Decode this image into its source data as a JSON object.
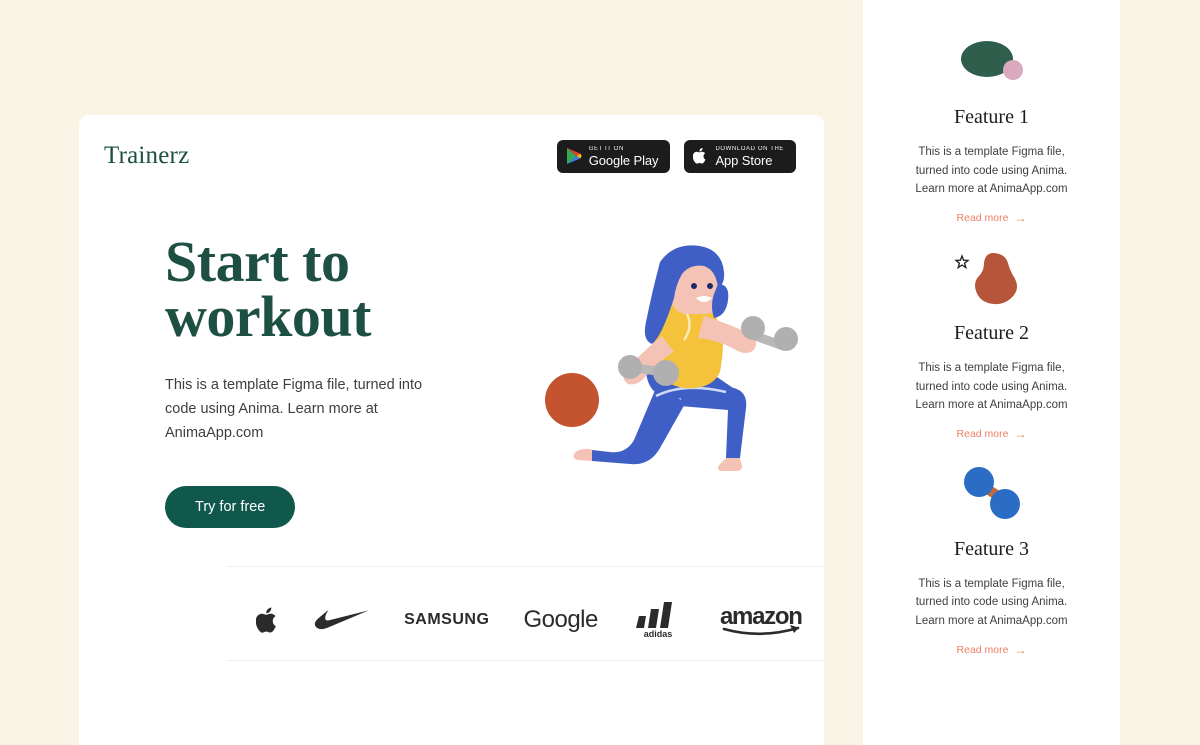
{
  "page": {
    "background_color": "#faf4e4",
    "card_background": "#ffffff",
    "accent_green": "#10584c",
    "accent_coral": "#ef7e63"
  },
  "hero": {
    "brand": "Trainerz",
    "title_line1": "Start to",
    "title_line2": "workout",
    "description": "This is a template Figma file, turned into code using Anima. Learn more at AnimaApp.com",
    "cta_label": "Try for free",
    "badges": [
      {
        "id": "google-play",
        "small": "GET IT ON",
        "big": "Google Play",
        "icon": "google-play-icon"
      },
      {
        "id": "app-store",
        "small": "Download on the",
        "big": "App Store",
        "icon": "apple-icon"
      }
    ],
    "illustration": {
      "name": "woman-lunging-with-dumbbells",
      "hair_color": "#3f5fc7",
      "shirt_color": "#f5c33b",
      "pants_color": "#3f5fc7",
      "skin_color": "#f4c3b5",
      "ball_color": "#c3542f",
      "dumbbell_color": "#b0b0b0"
    }
  },
  "brands": [
    {
      "name": "Apple",
      "icon": "apple-logo"
    },
    {
      "name": "Nike",
      "icon": "nike-swoosh-logo"
    },
    {
      "name": "SAMSUNG",
      "icon": "samsung-wordmark"
    },
    {
      "name": "Google",
      "icon": "google-wordmark"
    },
    {
      "name": "adidas",
      "icon": "adidas-logo"
    },
    {
      "name": "amazon",
      "icon": "amazon-wordmark"
    }
  ],
  "features": [
    {
      "title": "Feature 1",
      "description": "This is a template Figma file, turned into code using Anima. Learn more at AnimaApp.com",
      "link_label": "Read more",
      "link_arrow": "→",
      "icon": "green-ellipse-with-pink-circle",
      "colors": {
        "primary": "#2f5e4c",
        "secondary": "#dba9bd"
      }
    },
    {
      "title": "Feature 2",
      "description": "This is a template Figma file, turned into code using Anima. Learn more at AnimaApp.com",
      "link_label": "Read more",
      "link_arrow": "→",
      "icon": "terracotta-blob-with-star",
      "colors": {
        "primary": "#b5553a",
        "secondary": "#1c1c1c"
      }
    },
    {
      "title": "Feature 3",
      "description": "This is a template Figma file, turned into code using Anima. Learn more at AnimaApp.com",
      "link_label": "Read more",
      "link_arrow": "→",
      "icon": "blue-dumbbell",
      "colors": {
        "primary": "#2b6cc4",
        "secondary": "#c3683f"
      }
    }
  ]
}
